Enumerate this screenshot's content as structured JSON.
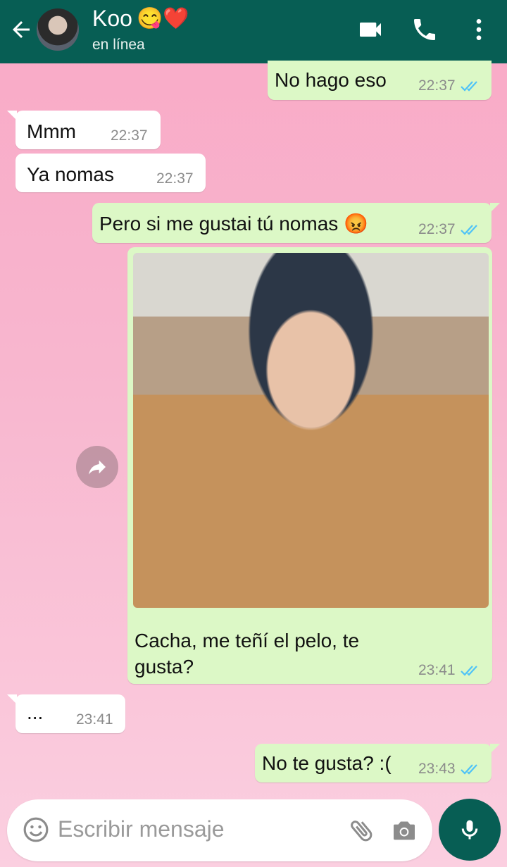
{
  "header": {
    "contact_name": "Koo",
    "contact_emojis": "😋❤️",
    "status": "en línea",
    "icons": [
      "back-arrow-icon",
      "video-call-icon",
      "phone-icon",
      "more-vert-icon"
    ]
  },
  "messages": [
    {
      "dir": "out",
      "text": "No hago eso",
      "time": "22:37",
      "read": true
    },
    {
      "dir": "in",
      "text": "Mmm",
      "time": "22:37"
    },
    {
      "dir": "in",
      "text": "Ya nomas",
      "time": "22:37"
    },
    {
      "dir": "out",
      "text": "Pero si me gustai tú nomas 😡",
      "time": "22:37",
      "read": true
    },
    {
      "dir": "out",
      "type": "image",
      "caption_line1": "Cacha, me teñí el pelo, te",
      "caption_line2": "gusta?",
      "time": "23:41",
      "read": true
    },
    {
      "dir": "in",
      "text": "...",
      "time": "23:41"
    },
    {
      "dir": "out",
      "text": "No te gusta? :(",
      "time": "23:43",
      "read": true
    }
  ],
  "composer": {
    "placeholder": "Escribir mensaje",
    "icons": [
      "emoji-icon",
      "attach-icon",
      "camera-icon",
      "mic-icon"
    ]
  },
  "colors": {
    "header": "#075e54",
    "outgoing_bubble": "#dcf8c6",
    "incoming_bubble": "#ffffff",
    "read_ticks": "#4fc3f7",
    "background": "#f9a9c6"
  }
}
